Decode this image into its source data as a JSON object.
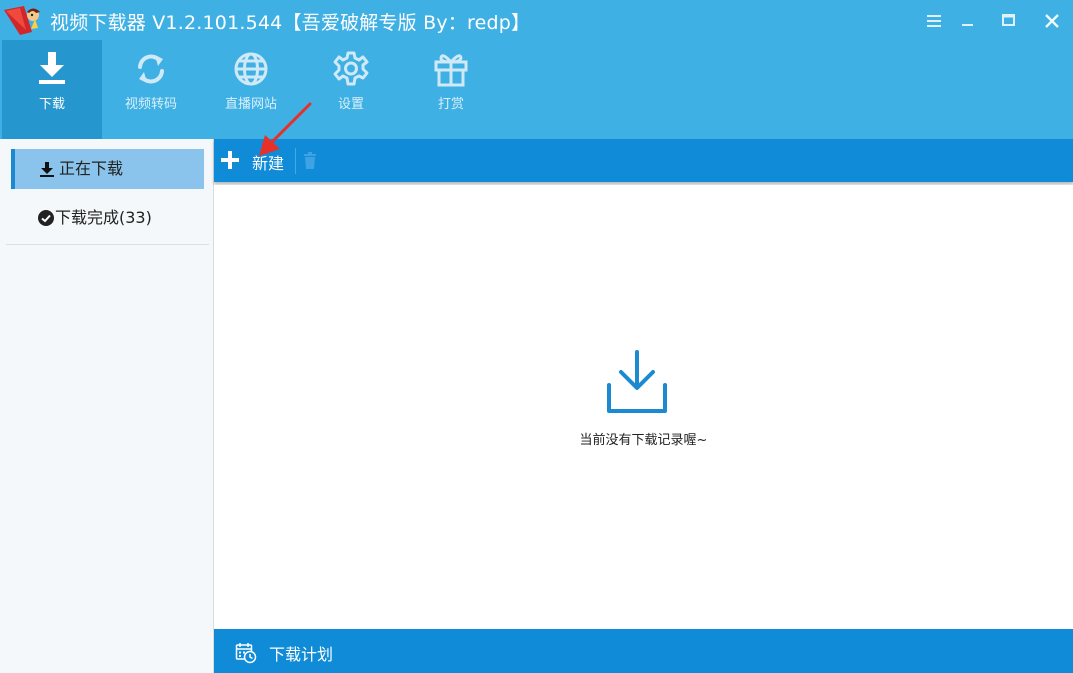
{
  "window": {
    "title": "视频下载器 V1.2.101.544【吾爱破解专版  By：redp】",
    "controls": [
      "menu-icon",
      "minimize-icon",
      "maximize-icon",
      "close-icon"
    ]
  },
  "nav": {
    "items": [
      {
        "label": "下载",
        "icon": "download-icon",
        "active": true
      },
      {
        "label": "视频转码",
        "icon": "sync-icon",
        "active": false
      },
      {
        "label": "直播网站",
        "icon": "globe-icon",
        "active": false
      },
      {
        "label": "设置",
        "icon": "gear-icon",
        "active": false
      },
      {
        "label": "打赏",
        "icon": "gift-icon",
        "active": false
      }
    ]
  },
  "sidebar": {
    "items": [
      {
        "label": "正在下载",
        "icon": "download-icon",
        "active": true
      },
      {
        "label": "下载完成(33)",
        "icon": "check-circle-icon",
        "active": false
      }
    ]
  },
  "toolbar": {
    "new_label": "新建",
    "new_icon": "plus-icon",
    "delete_icon": "trash-icon"
  },
  "content": {
    "empty_icon": "download-tray-icon",
    "empty_text": "当前没有下载记录喔~"
  },
  "bottombar": {
    "label": "下载计划",
    "icon": "calendar-clock-icon"
  },
  "colors": {
    "header": "#3fb0e4",
    "nav_active": "#2696cf",
    "toolbar": "#0f8bd7",
    "sidebar_active": "#8ac4ec",
    "annotation": "#e8302a"
  }
}
